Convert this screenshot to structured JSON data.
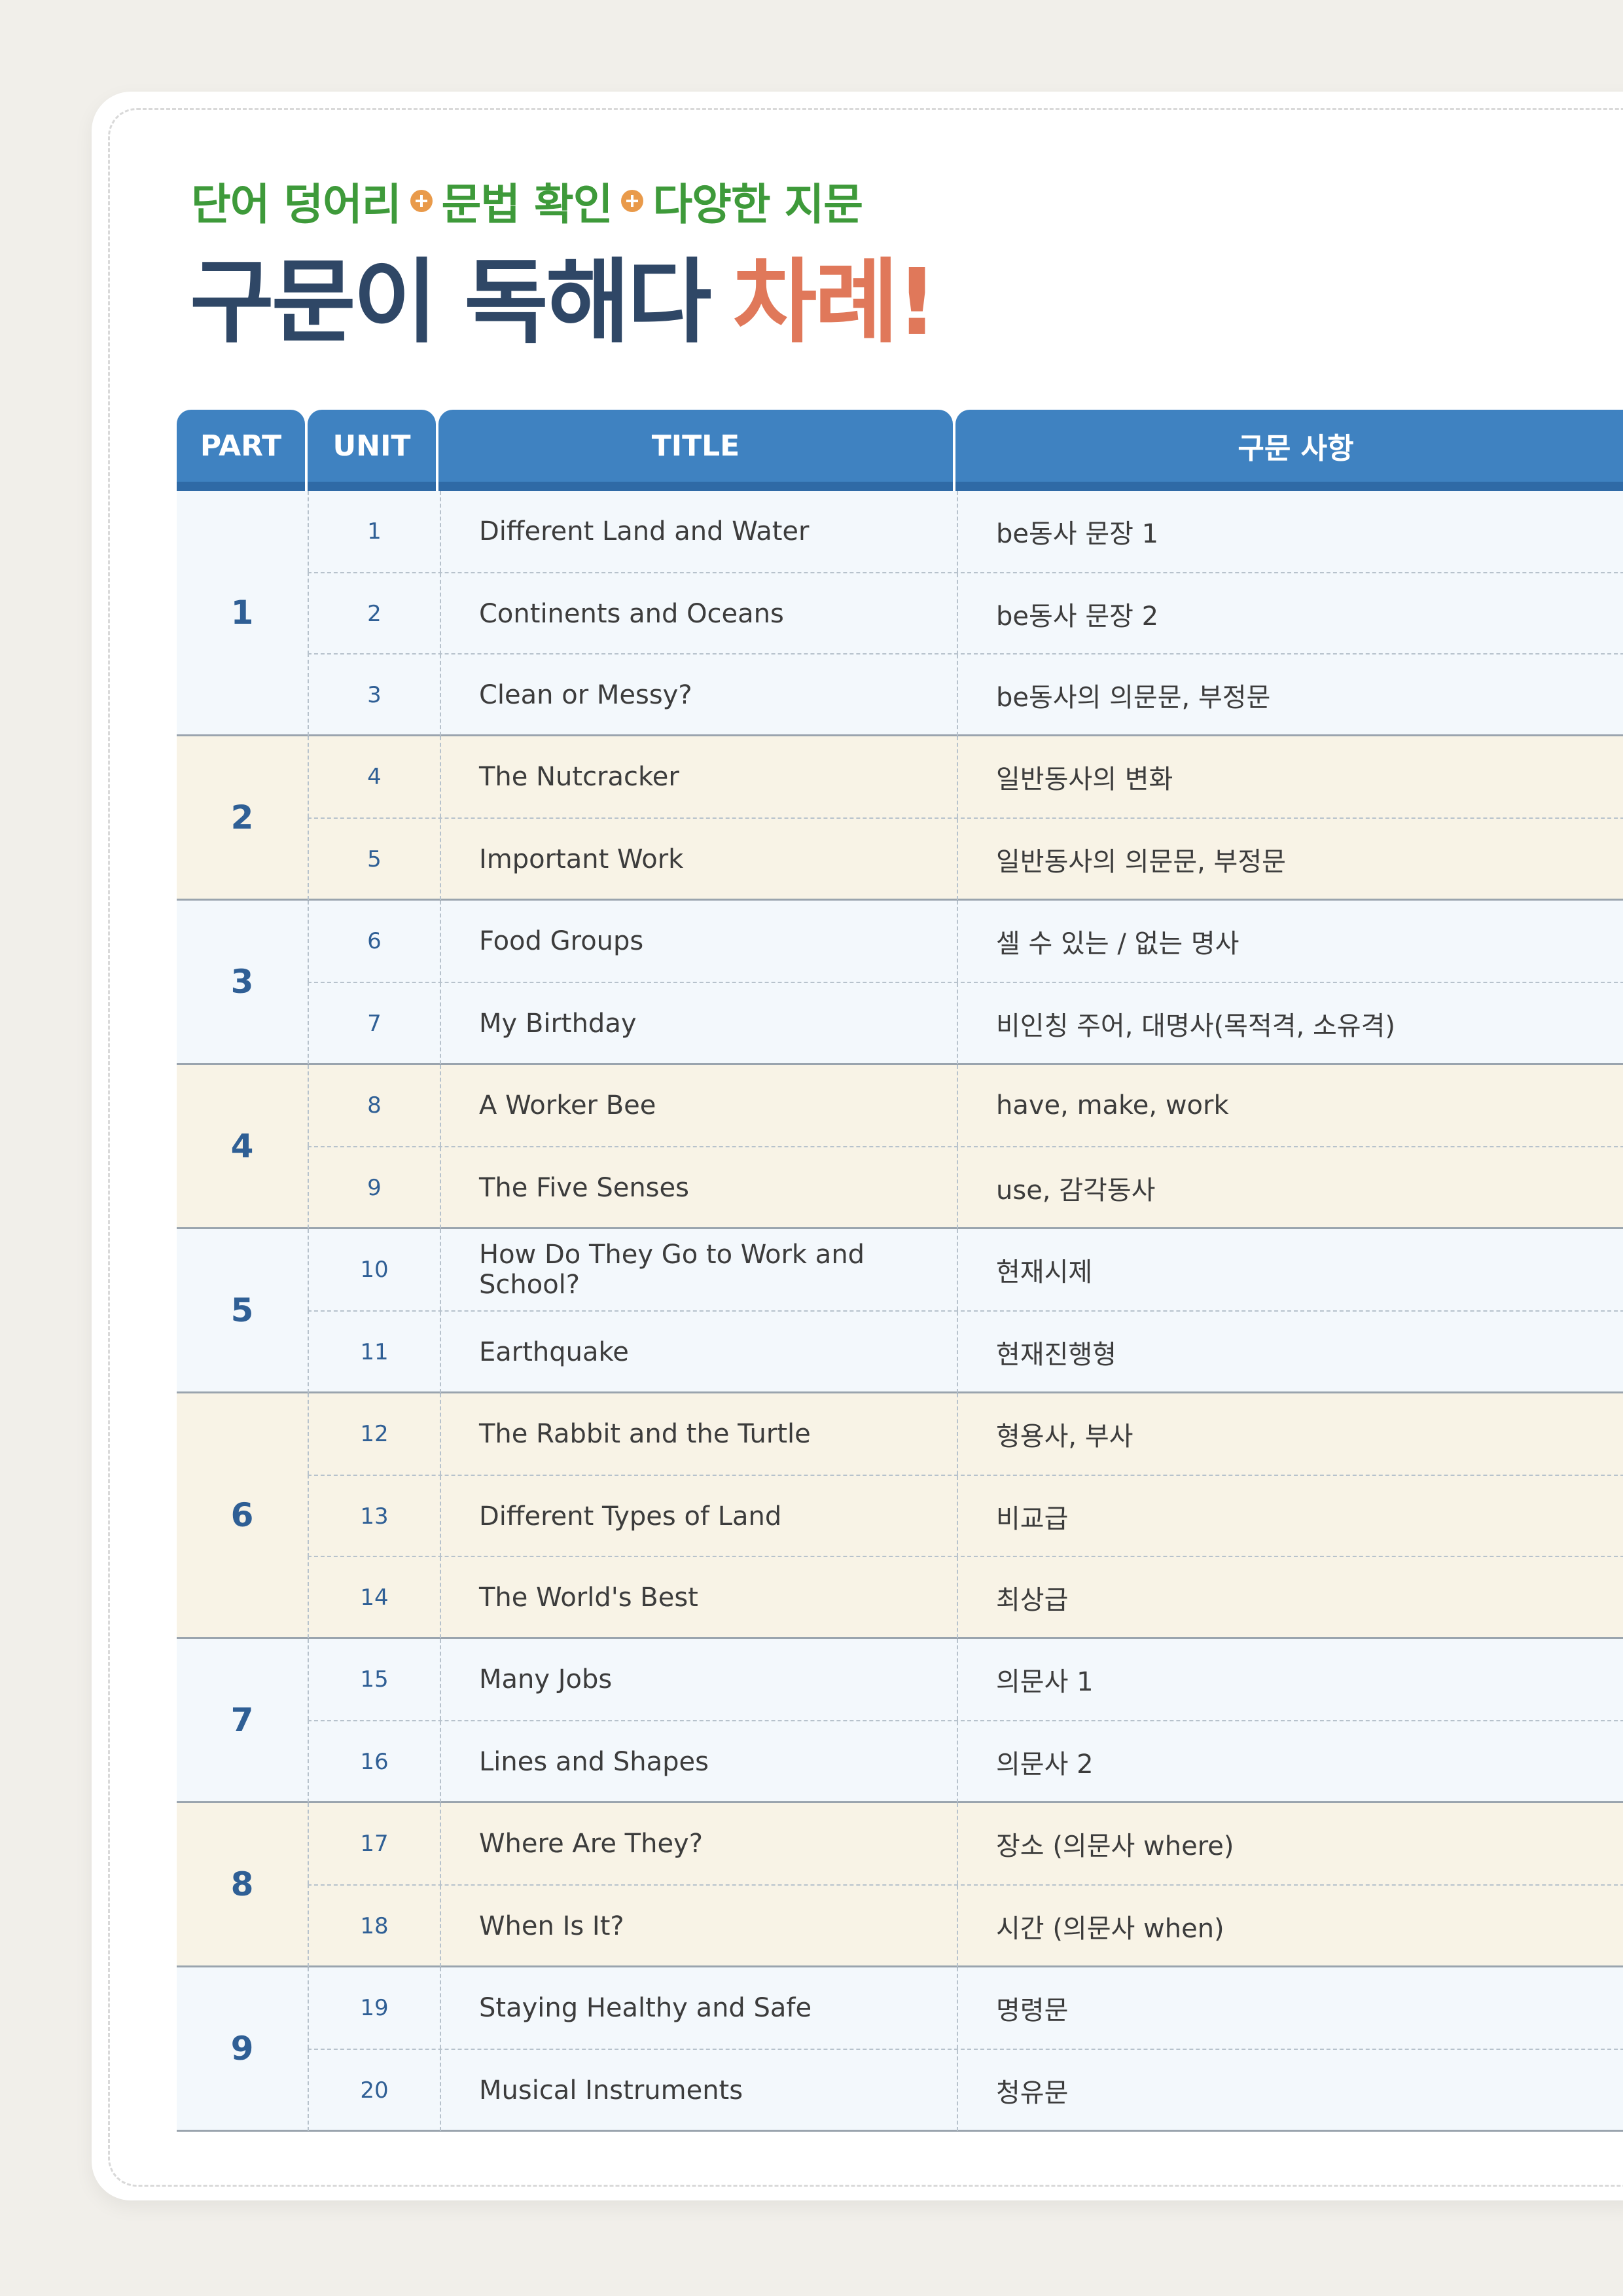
{
  "heading": {
    "subtitle_parts": [
      "단어 덩어리",
      "문법 확인",
      "다양한 지문"
    ],
    "title_main": "구문이 독해다",
    "title_accent": "차례!"
  },
  "table": {
    "headers": [
      "PART",
      "UNIT",
      "TITLE",
      "구문 사항"
    ],
    "parts": [
      {
        "part": "1",
        "units": [
          {
            "unit": "1",
            "title": "Different Land and Water",
            "grammar": "be동사 문장 1"
          },
          {
            "unit": "2",
            "title": "Continents and Oceans",
            "grammar": "be동사 문장 2"
          },
          {
            "unit": "3",
            "title": "Clean or Messy?",
            "grammar": "be동사의 의문문, 부정문"
          }
        ]
      },
      {
        "part": "2",
        "units": [
          {
            "unit": "4",
            "title": "The Nutcracker",
            "grammar": "일반동사의 변화"
          },
          {
            "unit": "5",
            "title": "Important Work",
            "grammar": "일반동사의 의문문, 부정문"
          }
        ]
      },
      {
        "part": "3",
        "units": [
          {
            "unit": "6",
            "title": "Food Groups",
            "grammar": "셀 수 있는 / 없는 명사"
          },
          {
            "unit": "7",
            "title": "My Birthday",
            "grammar": "비인칭 주어, 대명사(목적격, 소유격)"
          }
        ]
      },
      {
        "part": "4",
        "units": [
          {
            "unit": "8",
            "title": "A Worker Bee",
            "grammar": "have, make, work"
          },
          {
            "unit": "9",
            "title": "The Five Senses",
            "grammar": "use, 감각동사"
          }
        ]
      },
      {
        "part": "5",
        "units": [
          {
            "unit": "10",
            "title": "How Do They Go to Work and School?",
            "grammar": "현재시제"
          },
          {
            "unit": "11",
            "title": "Earthquake",
            "grammar": "현재진행형"
          }
        ]
      },
      {
        "part": "6",
        "units": [
          {
            "unit": "12",
            "title": "The Rabbit and the Turtle",
            "grammar": "형용사, 부사"
          },
          {
            "unit": "13",
            "title": "Different Types of Land",
            "grammar": "비교급"
          },
          {
            "unit": "14",
            "title": "The World's Best",
            "grammar": "최상급"
          }
        ]
      },
      {
        "part": "7",
        "units": [
          {
            "unit": "15",
            "title": "Many Jobs",
            "grammar": "의문사 1"
          },
          {
            "unit": "16",
            "title": "Lines and Shapes",
            "grammar": "의문사 2"
          }
        ]
      },
      {
        "part": "8",
        "units": [
          {
            "unit": "17",
            "title": "Where Are They?",
            "grammar": "장소 (의문사 where)"
          },
          {
            "unit": "18",
            "title": "When Is It?",
            "grammar": "시간 (의문사 when)"
          }
        ]
      },
      {
        "part": "9",
        "units": [
          {
            "unit": "19",
            "title": "Staying Healthy and Safe",
            "grammar": "명령문"
          },
          {
            "unit": "20",
            "title": "Musical Instruments",
            "grammar": "청유문"
          }
        ]
      }
    ]
  },
  "colors": {
    "header_blue": "#3f82c1",
    "row_light": "#f3f8fc",
    "row_cream": "#f8f3e6",
    "subtitle_green": "#3e9a3a",
    "title_navy": "#2f4766",
    "accent_coral": "#e0785a"
  }
}
